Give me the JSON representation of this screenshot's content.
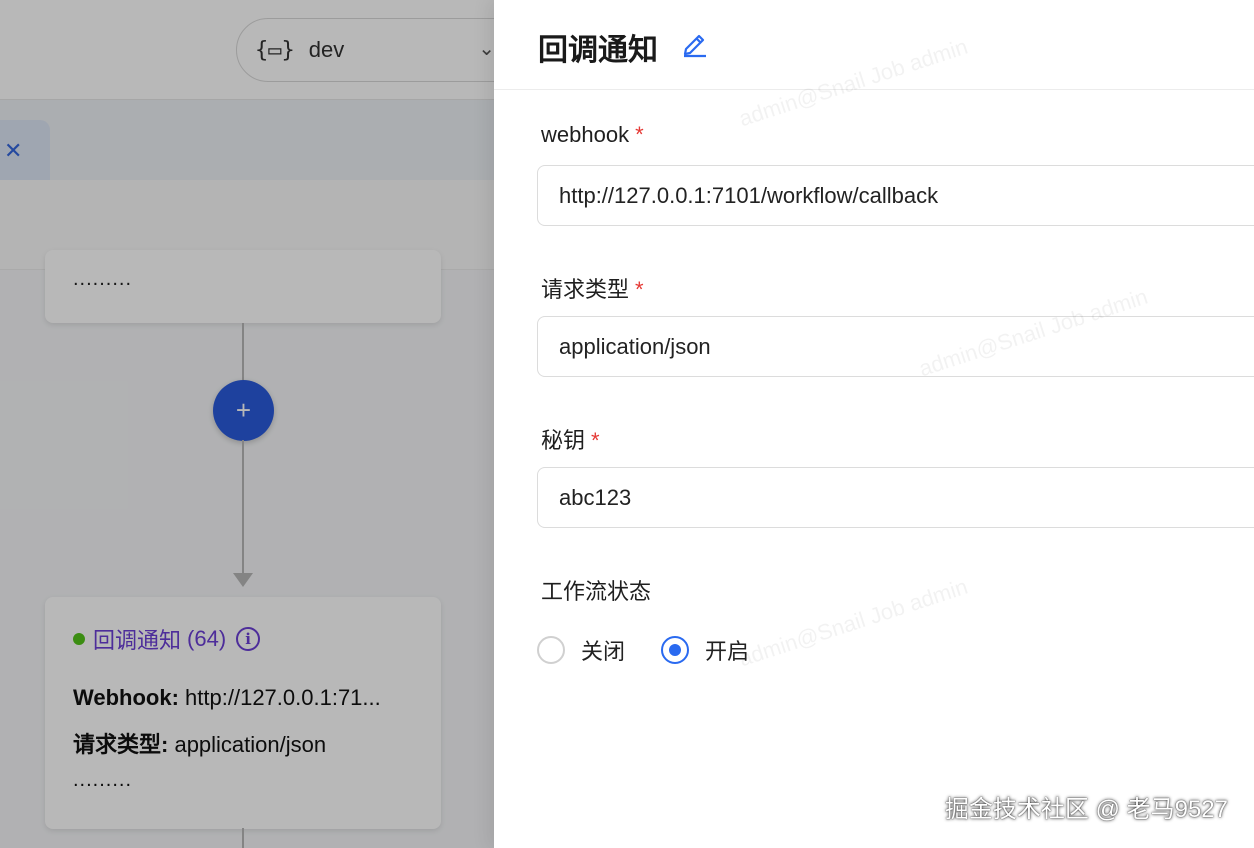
{
  "background": {
    "env_selector": {
      "icon": "{▭}",
      "value": "dev"
    },
    "tab_close_icon": "✕",
    "node_top": {
      "ellipsis": "........."
    },
    "add_node_icon": "+",
    "node_callback": {
      "title": "回调通知",
      "count": "(64)",
      "info_icon": "i",
      "webhook_key": "Webhook:",
      "webhook_value": "http://127.0.0.1:71...",
      "content_type_key": "请求类型:",
      "content_type_value": "application/json",
      "ellipsis": "........."
    }
  },
  "drawer": {
    "title": "回调通知",
    "fields": {
      "webhook": {
        "label": "webhook",
        "required_mark": "*",
        "value": "http://127.0.0.1:7101/workflow/callback"
      },
      "content_type": {
        "label": "请求类型",
        "required_mark": "*",
        "value": "application/json"
      },
      "secret": {
        "label": "秘钥",
        "required_mark": "*",
        "value": "abc123"
      },
      "workflow_status": {
        "label": "工作流状态",
        "options": [
          "关闭",
          "开启"
        ],
        "selected": "开启"
      }
    }
  },
  "watermark_text": "admin@Snail Job admin",
  "credit": "掘金技术社区 @ 老马9527",
  "colors": {
    "primary": "#2a6af0",
    "node_title": "#6b3fd6",
    "status_ok": "#52c41a",
    "required": "#e53935"
  }
}
